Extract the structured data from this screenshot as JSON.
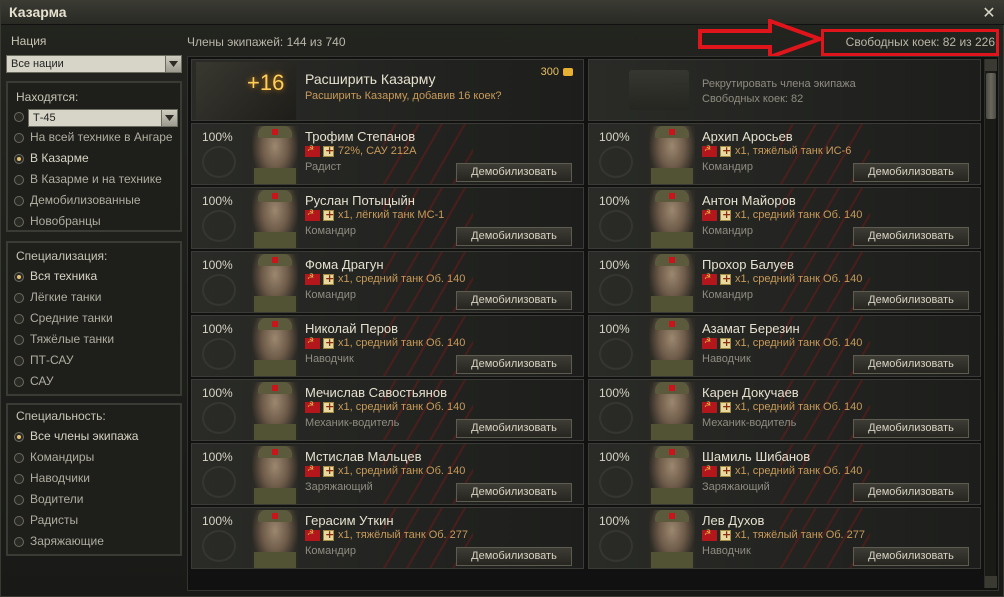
{
  "window": {
    "title": "Казарма",
    "close_label": "✕"
  },
  "sidebar": {
    "nation_label": "Нация",
    "nation_value": "Все нации",
    "location": {
      "header": "Находятся:",
      "tank_value": "Т-45",
      "options": [
        "На всей технике в Ангаре",
        "В Казарме",
        "В Казарме и на технике",
        "Демобилизованные",
        "Новобранцы"
      ],
      "selected": 1
    },
    "specialization": {
      "header": "Специализация:",
      "options": [
        "Вся техника",
        "Лёгкие танки",
        "Средние танки",
        "Тяжёлые танки",
        "ПТ-САУ",
        "САУ"
      ],
      "selected": 0
    },
    "specialty": {
      "header": "Специальность:",
      "options": [
        "Все члены экипажа",
        "Командиры",
        "Наводчики",
        "Водители",
        "Радисты",
        "Заряжающие"
      ],
      "selected": 0
    }
  },
  "header": {
    "members_count": "Члены экипажей: 144 из 740",
    "free_bunks": "Свободных коек: 82 из 226"
  },
  "top_cards": {
    "expand": {
      "plus": "+16",
      "title": "Расширить Казарму",
      "subtitle": "Расширить Казарму, добавив 16 коек?",
      "price": "300"
    },
    "recruit": {
      "title": "Рекрутировать члена экипажа",
      "subtitle": "Свободных коек: 82"
    }
  },
  "crew": [
    {
      "pct": "100%",
      "name": "Трофим Степанов",
      "info": "72%, САУ 212А",
      "role": "Радист",
      "button": "Демобилизовать"
    },
    {
      "pct": "100%",
      "name": "Архип Аросьев",
      "info": "x1, тяжёлый танк ИС-6",
      "role": "Командир",
      "button": "Демобилизовать"
    },
    {
      "pct": "100%",
      "name": "Руслан Потыцыйн",
      "info": "x1, лёгкий танк МС-1",
      "role": "Командир",
      "button": "Демобилизовать"
    },
    {
      "pct": "100%",
      "name": "Антон Майоров",
      "info": "x1, средний танк Об. 140",
      "role": "Командир",
      "button": "Демобилизовать"
    },
    {
      "pct": "100%",
      "name": "Фома Драгун",
      "info": "x1, средний танк Об. 140",
      "role": "Командир",
      "button": "Демобилизовать"
    },
    {
      "pct": "100%",
      "name": "Прохор Балуев",
      "info": "x1, средний танк Об. 140",
      "role": "Командир",
      "button": "Демобилизовать"
    },
    {
      "pct": "100%",
      "name": "Николай Перов",
      "info": "x1, средний танк Об. 140",
      "role": "Наводчик",
      "button": "Демобилизовать"
    },
    {
      "pct": "100%",
      "name": "Азамат Березин",
      "info": "x1, средний танк Об. 140",
      "role": "Наводчик",
      "button": "Демобилизовать"
    },
    {
      "pct": "100%",
      "name": "Мечислав Савостьянов",
      "info": "x1, средний танк Об. 140",
      "role": "Механик-водитель",
      "button": "Демобилизовать"
    },
    {
      "pct": "100%",
      "name": "Карен Докучаев",
      "info": "x1, средний танк Об. 140",
      "role": "Механик-водитель",
      "button": "Демобилизовать"
    },
    {
      "pct": "100%",
      "name": "Мстислав Мальцев",
      "info": "x1, средний танк Об. 140",
      "role": "Заряжающий",
      "button": "Демобилизовать"
    },
    {
      "pct": "100%",
      "name": "Шамиль Шибанов",
      "info": "x1, средний танк Об. 140",
      "role": "Заряжающий",
      "button": "Демобилизовать"
    },
    {
      "pct": "100%",
      "name": "Герасим Уткин",
      "info": "x1, тяжёлый танк Об. 277",
      "role": "Командир",
      "button": "Демобилизовать"
    },
    {
      "pct": "100%",
      "name": "Лев Духов",
      "info": "x1, тяжёлый танк Об. 277",
      "role": "Наводчик",
      "button": "Демобилизовать"
    }
  ]
}
